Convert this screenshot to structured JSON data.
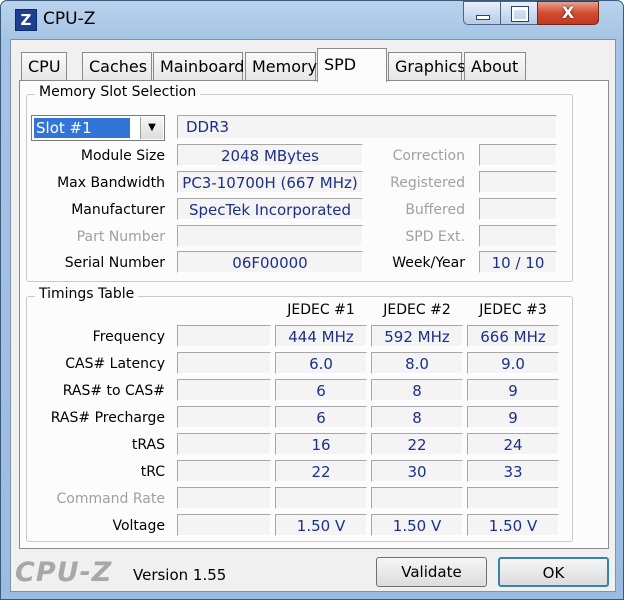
{
  "window": {
    "title": "CPU-Z",
    "icon_letter": "Z",
    "close_glyph": "X"
  },
  "tabs": [
    "CPU",
    "Caches",
    "Mainboard",
    "Memory",
    "SPD",
    "Graphics",
    "About"
  ],
  "active_tab": "SPD",
  "slot_selection": {
    "group_title": "Memory Slot Selection",
    "slot_value": "Slot #1",
    "memory_type": "DDR3",
    "module_size_label": "Module Size",
    "module_size": "2048 MBytes",
    "max_bandwidth_label": "Max Bandwidth",
    "max_bandwidth": "PC3-10700H (667 MHz)",
    "manufacturer_label": "Manufacturer",
    "manufacturer": "SpecTek Incorporated",
    "part_number_label": "Part Number",
    "part_number": "",
    "serial_number_label": "Serial Number",
    "serial_number": "06F00000",
    "correction_label": "Correction",
    "correction": "",
    "registered_label": "Registered",
    "registered": "",
    "buffered_label": "Buffered",
    "buffered": "",
    "spd_ext_label": "SPD Ext.",
    "spd_ext": "",
    "week_year_label": "Week/Year",
    "week_year": "10 / 10"
  },
  "timings": {
    "group_title": "Timings Table",
    "columns": [
      "JEDEC #1",
      "JEDEC #2",
      "JEDEC #3"
    ],
    "rows": [
      {
        "label": "Frequency",
        "values": [
          "444 MHz",
          "592 MHz",
          "666 MHz"
        ],
        "dim": false
      },
      {
        "label": "CAS# Latency",
        "values": [
          "6.0",
          "8.0",
          "9.0"
        ],
        "dim": false
      },
      {
        "label": "RAS# to CAS#",
        "values": [
          "6",
          "8",
          "9"
        ],
        "dim": false
      },
      {
        "label": "RAS# Precharge",
        "values": [
          "6",
          "8",
          "9"
        ],
        "dim": false
      },
      {
        "label": "tRAS",
        "values": [
          "16",
          "22",
          "24"
        ],
        "dim": false
      },
      {
        "label": "tRC",
        "values": [
          "22",
          "30",
          "33"
        ],
        "dim": false
      },
      {
        "label": "Command Rate",
        "values": [
          "",
          "",
          ""
        ],
        "dim": true
      },
      {
        "label": "Voltage",
        "values": [
          "1.50 V",
          "1.50 V",
          "1.50 V"
        ],
        "dim": false
      }
    ]
  },
  "footer": {
    "brand": "CPU-Z",
    "version": "Version 1.55",
    "validate_label": "Validate",
    "ok_label": "OK"
  },
  "colors": {
    "value_text": "#1c2f8a",
    "select_highlight": "#3375d6",
    "dim_label": "#a0a0a0"
  }
}
